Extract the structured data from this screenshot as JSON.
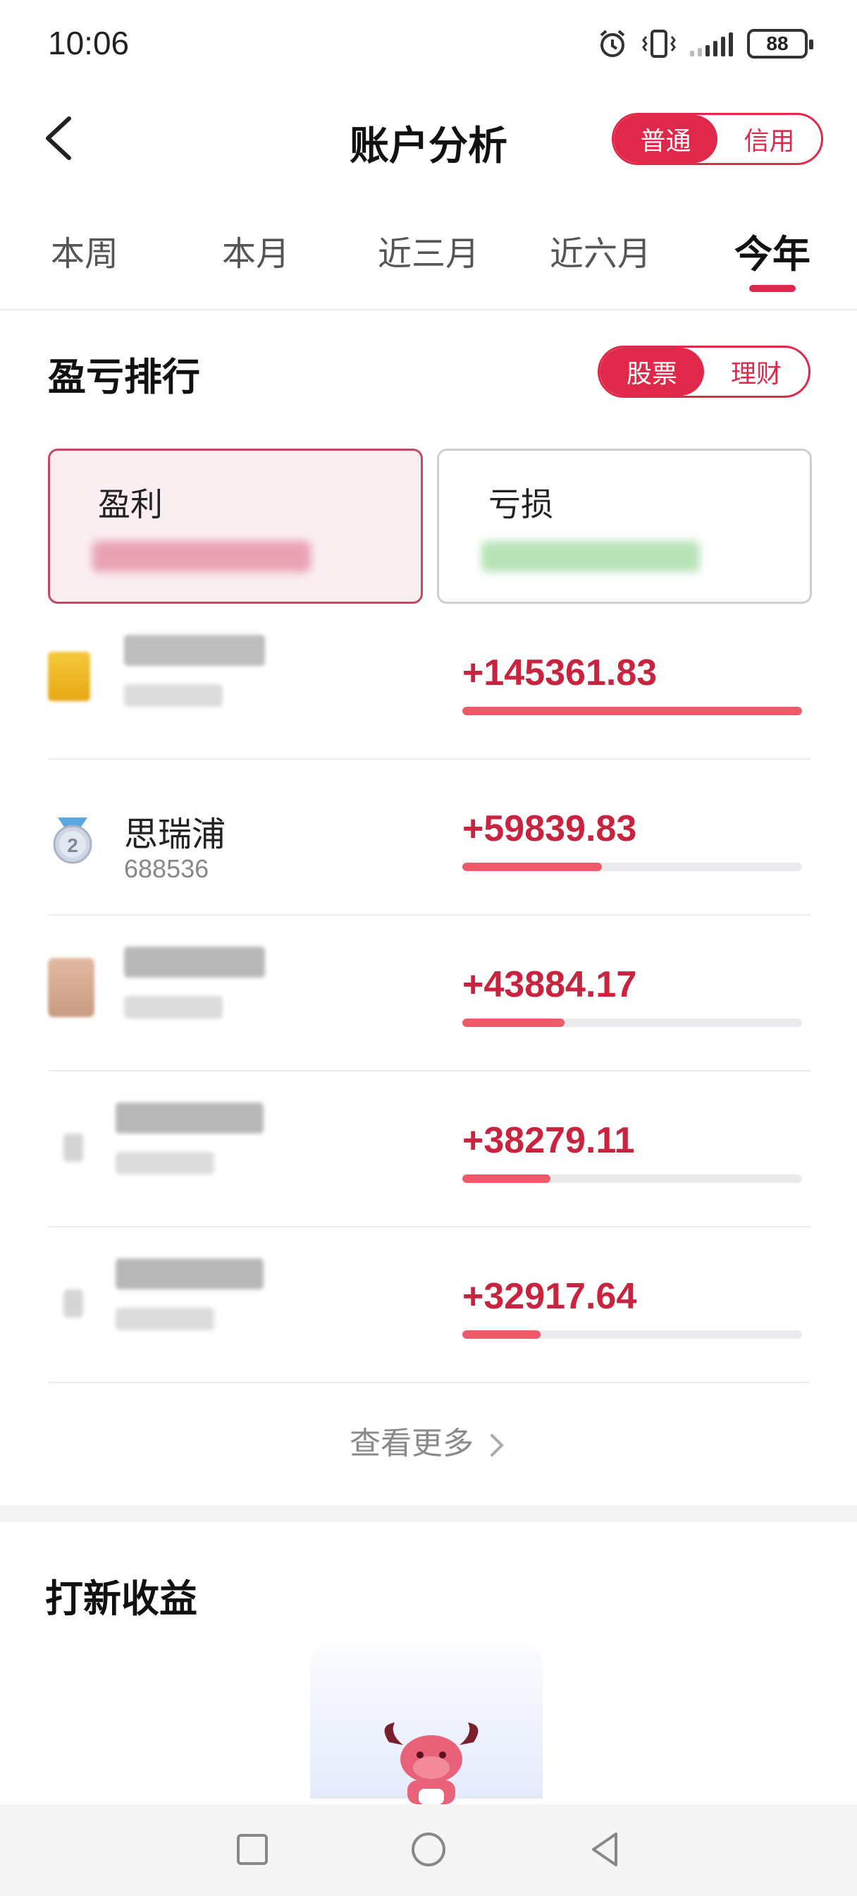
{
  "status_bar": {
    "time": "10:06",
    "battery": "88"
  },
  "header": {
    "title": "账户分析",
    "account_toggle": [
      "普通",
      "信用"
    ],
    "account_active": "普通"
  },
  "period_tabs": [
    "本周",
    "本月",
    "近三月",
    "近六月",
    "今年"
  ],
  "period_active": "今年",
  "ranking": {
    "title": "盈亏排行",
    "type_toggle": [
      "股票",
      "理财"
    ],
    "type_active": "股票",
    "profit_card_label": "盈利",
    "loss_card_label": "亏损",
    "rows": [
      {
        "rank": 1,
        "name": "",
        "code": "",
        "pnl": "+145361.83",
        "ratio": 1.0
      },
      {
        "rank": 2,
        "name": "思瑞浦",
        "code": "688536",
        "pnl": "+59839.83",
        "ratio": 0.41
      },
      {
        "rank": 3,
        "name": "",
        "code": "",
        "pnl": "+43884.17",
        "ratio": 0.3
      },
      {
        "rank": 4,
        "name": "",
        "code": "",
        "pnl": "+38279.11",
        "ratio": 0.26
      },
      {
        "rank": 5,
        "name": "",
        "code": "",
        "pnl": "+32917.64",
        "ratio": 0.23
      }
    ],
    "view_more": "查看更多"
  },
  "ipo_section": {
    "title": "打新收益"
  },
  "colors": {
    "accent": "#e0284a",
    "profit_text": "#c8243f",
    "bar": "#ef5a6a"
  },
  "nav_icons": [
    "square-icon",
    "circle-icon",
    "triangle-back-icon"
  ]
}
